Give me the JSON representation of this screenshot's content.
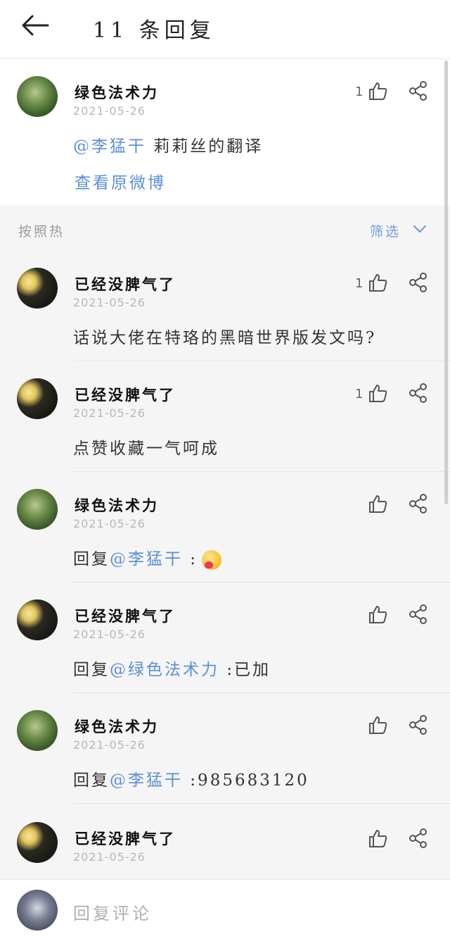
{
  "header": {
    "title": "11 条回复"
  },
  "main_comment": {
    "username": "绿色法术力",
    "date": "2021-05-26",
    "likes": "1",
    "mention": "@李猛干",
    "text": " 莉莉丝的翻译",
    "view_original": "查看原微博"
  },
  "sort": {
    "label": "按照热",
    "filter_label": "筛选"
  },
  "replies": [
    {
      "username": "已经没脾气了",
      "date": "2021-05-26",
      "likes": "1",
      "prefix": "话说大佬在特珞的黑暗世界版发文吗?",
      "mention": "",
      "suffix": ""
    },
    {
      "username": "已经没脾气了",
      "date": "2021-05-26",
      "likes": "1",
      "prefix": "点赞收藏一气呵成",
      "mention": "",
      "suffix": ""
    },
    {
      "username": "绿色法术力",
      "date": "2021-05-26",
      "likes": "",
      "prefix": "回复",
      "mention": "@李猛干",
      "suffix": " :"
    },
    {
      "username": "已经没脾气了",
      "date": "2021-05-26",
      "likes": "",
      "prefix": "回复",
      "mention": "@绿色法术力",
      "suffix": " :已加"
    },
    {
      "username": "绿色法术力",
      "date": "2021-05-26",
      "likes": "",
      "prefix": "回复",
      "mention": "@李猛干",
      "suffix": " :985683120"
    },
    {
      "username": "已经没脾气了",
      "date": "2021-05-26",
      "likes": "",
      "prefix": "",
      "mention": "",
      "suffix": ""
    }
  ],
  "bottom": {
    "placeholder": "回复评论"
  },
  "icons": {
    "back": "arrow-left-icon",
    "like": "thumbs-up-icon",
    "share": "share-icon",
    "filter": "chevron-down-icon"
  },
  "colors": {
    "mention": "#5b8fd6",
    "background": "#f5f5f5"
  }
}
